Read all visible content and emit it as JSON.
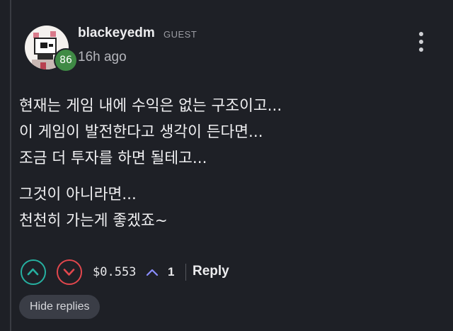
{
  "comment": {
    "author": {
      "username": "blackeyedm",
      "role_tag": "GUEST",
      "level": "86",
      "avatar_icon": "pixel-character-avatar"
    },
    "timestamp": "16h ago",
    "menu_icon": "vertical-dots-icon",
    "paragraphs": [
      [
        "현재는 게임 내에 수익은 없는 구조이고...",
        "이 게임이 발전한다고 생각이 든다면...",
        "조금 더 투자를 하면 될테고..."
      ],
      [
        "그것이 아니라면...",
        "천천히 가는게 좋겠죠~"
      ]
    ],
    "actions": {
      "upvote_icon": "chevron-up-circle-icon",
      "downvote_icon": "chevron-down-circle-icon",
      "payout": "$0.553",
      "payout_icon": "caret-up-icon",
      "vote_count": "1",
      "reply_label": "Reply"
    },
    "hide_replies_label": "Hide replies"
  },
  "colors": {
    "background": "#1e2026",
    "upvote": "#26b0a0",
    "downvote": "#e2474d",
    "level_badge": "#3f8a45",
    "caret": "#8a8dff"
  }
}
